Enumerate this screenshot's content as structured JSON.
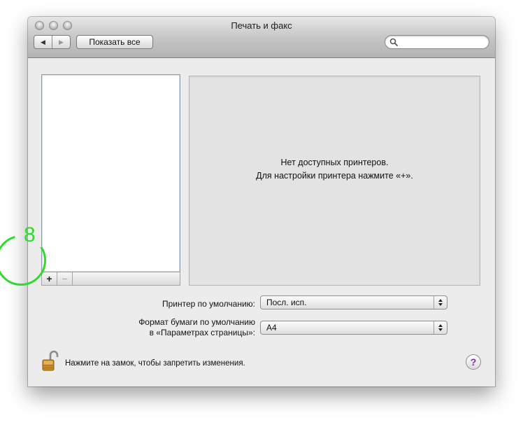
{
  "window": {
    "title": "Печать и факс"
  },
  "toolbar": {
    "back_icon": "◀",
    "forward_icon": "▶",
    "show_all_label": "Показать все",
    "search_placeholder": "",
    "search_value": ""
  },
  "printer_list": {
    "items": [],
    "add_label": "+",
    "remove_label": "−"
  },
  "annotation": {
    "step_number": "8",
    "color": "#2ddc2d"
  },
  "detail": {
    "empty_line1": "Нет доступных принтеров.",
    "empty_line2": "Для настройки принтера нажмите «+»."
  },
  "settings": {
    "default_printer_label": "Принтер по умолчанию:",
    "default_printer_value": "Посл. исп.",
    "paper_label_line1": "Формат бумаги по умолчанию",
    "paper_label_line2": "в «Параметрах страницы»:",
    "paper_value": "A4"
  },
  "footer": {
    "lock_message": "Нажмите на замок, чтобы запретить изменения.",
    "help_label": "?"
  }
}
